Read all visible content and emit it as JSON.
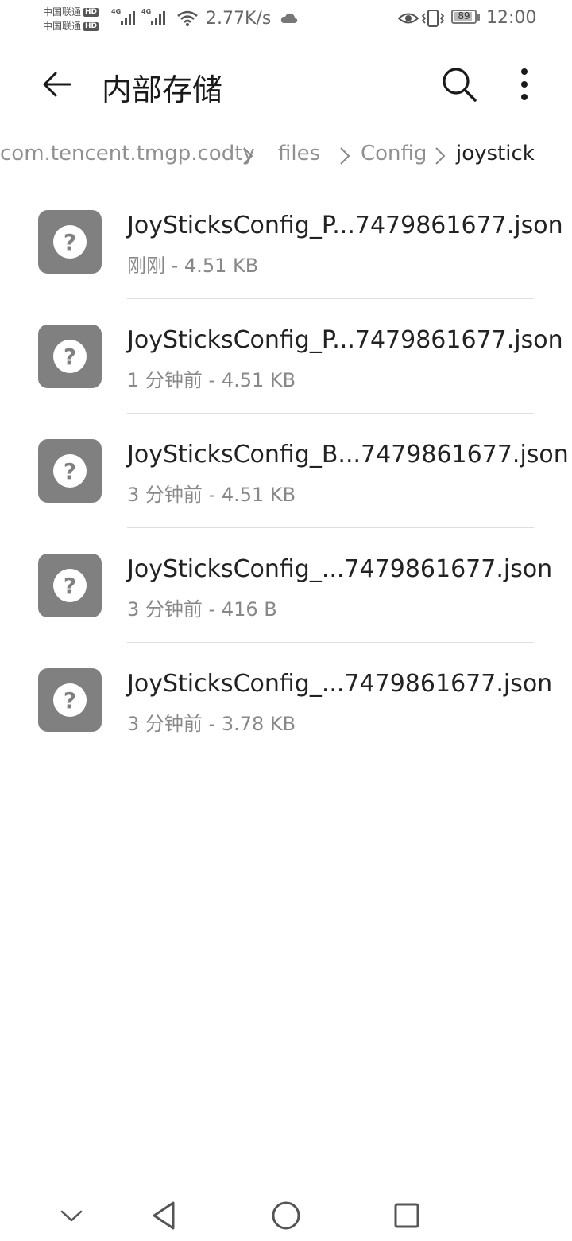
{
  "status_bar": {
    "carrier_1": "中国联通",
    "carrier_2": "中国联通",
    "hd_badge": "HD",
    "network_type": "4G",
    "net_speed": "2.77K/s",
    "battery_level": "89",
    "battery_fraction": 0.89,
    "time": "12:00"
  },
  "app_bar": {
    "title": "内部存储",
    "back_icon": "arrow-left-icon",
    "search_icon": "search-icon",
    "more_icon": "more-vertical-icon"
  },
  "breadcrumb": {
    "items": [
      "com.tencent.tmgp.codty",
      "files",
      "Config",
      "joystick"
    ],
    "separator_icon": "chevron-right-icon"
  },
  "files": [
    {
      "name": "JoySticksConfig_P...7479861677.json",
      "meta": "刚刚 - 4.51 KB",
      "icon": "unknown-file-icon"
    },
    {
      "name": "JoySticksConfig_P...7479861677.json",
      "meta": "1 分钟前 - 4.51 KB",
      "icon": "unknown-file-icon"
    },
    {
      "name": "JoySticksConfig_B...7479861677.json",
      "meta": "3 分钟前 - 4.51 KB",
      "icon": "unknown-file-icon"
    },
    {
      "name": "JoySticksConfig_...7479861677.json",
      "meta": "3 分钟前 - 416 B",
      "icon": "unknown-file-icon"
    },
    {
      "name": "JoySticksConfig_...7479861677.json",
      "meta": "3 分钟前 - 3.78 KB",
      "icon": "unknown-file-icon"
    }
  ],
  "colors": {
    "file_icon_bg": "#808080",
    "breadcrumb_inactive": "#909090",
    "breadcrumb_active": "#1f1f1f"
  }
}
